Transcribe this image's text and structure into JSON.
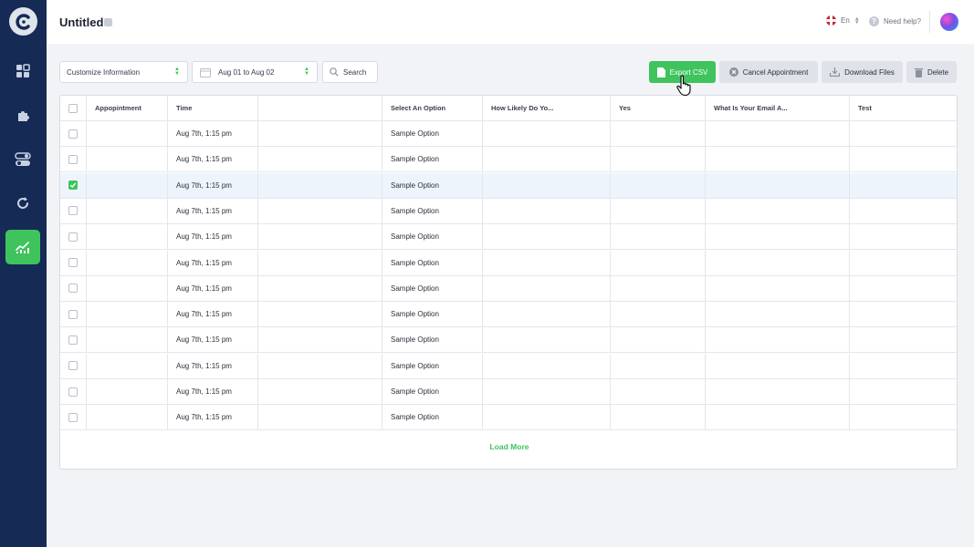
{
  "header": {
    "title": "Untitled",
    "language": "En",
    "help_label": "Need help?"
  },
  "toolbar": {
    "customize_select": "Customize Information",
    "date_range": "Aug 01 to Aug 02",
    "search_placeholder": "Search",
    "export_label": "Export CSV",
    "cancel_label": "Cancel Appointment",
    "download_label": "Download Files",
    "delete_label": "Delete"
  },
  "table": {
    "columns": [
      "Appopintment",
      "Time",
      "",
      "Select An Option",
      "How Likely Do Yo...",
      "Yes",
      "What Is Your Email A...",
      "Test"
    ],
    "rows": [
      {
        "time": "Aug 7th, 1:15 pm",
        "option": "Sample Option",
        "checked": false
      },
      {
        "time": "Aug 7th, 1:15 pm",
        "option": "Sample Option",
        "checked": false
      },
      {
        "time": "Aug 7th, 1:15 pm",
        "option": "Sample Option",
        "checked": true
      },
      {
        "time": "Aug 7th, 1:15 pm",
        "option": "Sample Option",
        "checked": false
      },
      {
        "time": "Aug 7th, 1:15 pm",
        "option": "Sample Option",
        "checked": false
      },
      {
        "time": "Aug 7th, 1:15 pm",
        "option": "Sample Option",
        "checked": false
      },
      {
        "time": "Aug 7th, 1:15 pm",
        "option": "Sample Option",
        "checked": false
      },
      {
        "time": "Aug 7th, 1:15 pm",
        "option": "Sample Option",
        "checked": false
      },
      {
        "time": "Aug 7th, 1:15 pm",
        "option": "Sample Option",
        "checked": false
      },
      {
        "time": "Aug 7th, 1:15 pm",
        "option": "Sample Option",
        "checked": false
      },
      {
        "time": "Aug 7th, 1:15 pm",
        "option": "Sample Option",
        "checked": false
      },
      {
        "time": "Aug 7th, 1:15 pm",
        "option": "Sample Option",
        "checked": false
      }
    ],
    "load_more": "Load More"
  },
  "sidebar": {
    "items": [
      {
        "icon": "dashboard-icon",
        "active": false
      },
      {
        "icon": "puzzle-icon",
        "active": false
      },
      {
        "icon": "toggles-icon",
        "active": false
      },
      {
        "icon": "sync-icon",
        "active": false
      },
      {
        "icon": "analytics-icon",
        "active": true
      }
    ]
  },
  "colors": {
    "sidebar_bg": "#152a55",
    "accent_green": "#3fc35d",
    "page_bg": "#f1f3f7"
  }
}
